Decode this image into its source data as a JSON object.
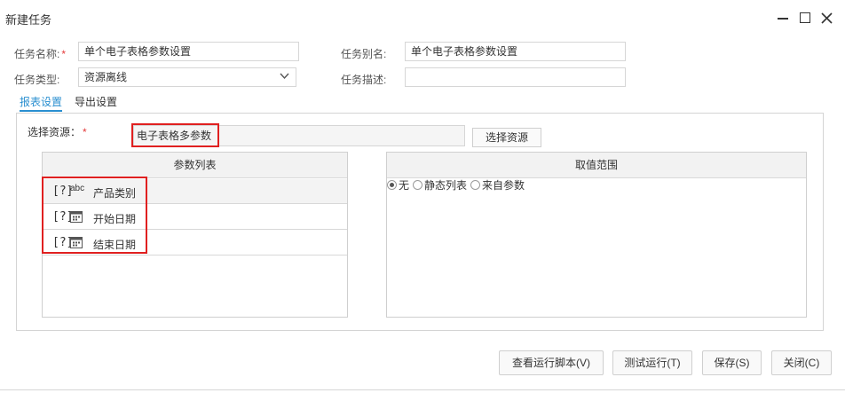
{
  "window": {
    "title": "新建任务"
  },
  "form": {
    "task_name_label": "任务名称:",
    "task_name_value": "单个电子表格参数设置",
    "task_alias_label": "任务别名:",
    "task_alias_value": "单个电子表格参数设置",
    "task_type_label": "任务类型:",
    "task_type_value": "资源离线",
    "task_desc_label": "任务描述:",
    "task_desc_value": "",
    "required_mark": "*"
  },
  "tabs": [
    {
      "label": "报表设置",
      "active": true
    },
    {
      "label": "导出设置",
      "active": false
    }
  ],
  "report_settings": {
    "select_resource_label": "选择资源：",
    "resource_value": "电子表格多参数",
    "select_resource_button": "选择资源",
    "param_list_header": "参数列表",
    "value_range_header": "取值范围",
    "params": [
      {
        "marker": "[?]",
        "type_icon": "abc",
        "name": "产品类别"
      },
      {
        "marker": "[?]",
        "type_icon": "date-icon",
        "name": "开始日期"
      },
      {
        "marker": "[?]",
        "type_icon": "date-icon",
        "name": "结束日期"
      }
    ],
    "range_options": [
      {
        "label": "无",
        "checked": true
      },
      {
        "label": "静态列表",
        "checked": false
      },
      {
        "label": "来自参数",
        "checked": false
      }
    ]
  },
  "footer": {
    "view_script_button": "查看运行脚本(V)",
    "test_run_button": "测试运行(T)",
    "save_button": "保存(S)",
    "close_button": "关闭(C)"
  },
  "colors": {
    "accent": "#2a8fd0",
    "highlight": "#e02020",
    "required": "#e43a3a"
  }
}
